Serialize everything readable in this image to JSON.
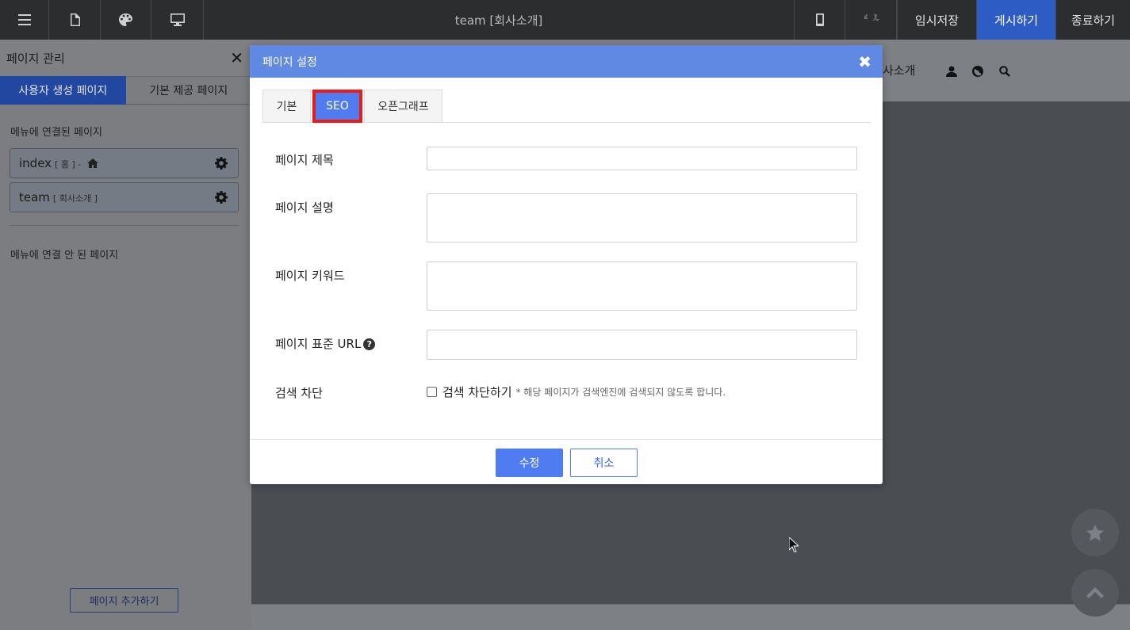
{
  "topbar": {
    "title": "team [회사소개]",
    "temp_save": "임시저장",
    "publish": "게시하기",
    "exit": "종료하기",
    "colors": {
      "background": "#2c2d2f",
      "publish_bg": "#2d5cc4"
    }
  },
  "sidebar": {
    "title": "페이지 관리",
    "tabs": [
      "사용자 생성 페이지",
      "기본 제공 페이지"
    ],
    "linked_section": "메뉴에 연결된 페이지",
    "pages": [
      {
        "name": "index",
        "sub": "[ 홈 ] -",
        "home": true
      },
      {
        "name": "team",
        "sub": "[ 회사소개 ]",
        "home": false
      }
    ],
    "unlinked_section": "메뉴에 연결 안 된 페이지",
    "add_button": "페이지 추가하기"
  },
  "canvas": {
    "nav_text": "사소개"
  },
  "modal": {
    "title": "페이지 설정",
    "tabs": [
      "기본",
      "SEO",
      "오픈그래프"
    ],
    "active_tab": "SEO",
    "fields": {
      "page_title": {
        "label": "페이지 제목",
        "value": ""
      },
      "page_description": {
        "label": "페이지 설명",
        "value": ""
      },
      "page_keywords": {
        "label": "페이지 키워드",
        "value": ""
      },
      "canonical_url": {
        "label": "페이지 표준 URL",
        "value": "",
        "help": "?"
      }
    },
    "search_block": {
      "label": "검색 차단",
      "checkbox_label": "검색 차단하기",
      "note": "* 해당 페이지가 검색엔진에 검색되지 않도록 합니다.",
      "checked": false
    },
    "buttons": {
      "submit": "수정",
      "cancel": "취소"
    },
    "colors": {
      "header": "#6089e4",
      "primary": "#4f7cf0",
      "highlight": "#f01a14"
    }
  }
}
